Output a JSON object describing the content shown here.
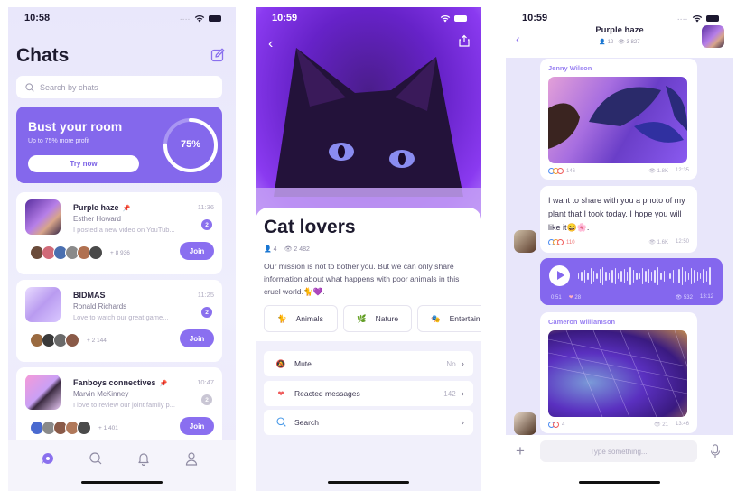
{
  "colors": {
    "accent": "#8468ec",
    "background": "#e9e7fb",
    "text_dark": "#1d1a2e"
  },
  "screen1": {
    "status_time": "10:58",
    "title": "Chats",
    "compose_icon": "edit-icon",
    "search_placeholder": "Search by chats",
    "promo": {
      "title": "Bust your room",
      "subtitle": "Up to 75% more profit",
      "button": "Try now",
      "progress_label": "75%",
      "progress_fraction": 0.75
    },
    "chats": [
      {
        "name": "Purple haze",
        "pinned": true,
        "author": "Esther Howard",
        "message": "I posted a new video on YouTub...",
        "time": "11:36",
        "unread": "2",
        "members_more": "+ 8 936",
        "join_label": "Join"
      },
      {
        "name": "BIDMAS",
        "pinned": false,
        "author": "Ronald Richards",
        "message": "Love to watch our great game...",
        "time": "11:25",
        "unread": "2",
        "members_more": "+ 2 144",
        "join_label": "Join"
      },
      {
        "name": "Fanboys connectives",
        "pinned": true,
        "author": "Marvin McKinney",
        "message": "I love to review our joint family p...",
        "time": "10:47",
        "unread": "2",
        "members_more": "+ 1 401",
        "join_label": "Join"
      }
    ],
    "tabs": [
      "chats-icon",
      "search-icon",
      "bell-icon",
      "profile-icon"
    ]
  },
  "screen2": {
    "status_time": "10:59",
    "title": "Cat lovers",
    "members": "4",
    "views": "2 482",
    "description": "Our mission is not to bother you. But we can only share information about what happens with poor animals in this cruel world.🐈💜.",
    "categories": [
      {
        "emoji": "🐈",
        "label": "Animals"
      },
      {
        "emoji": "🌿",
        "label": "Nature"
      },
      {
        "emoji": "🎭",
        "label": "Entertain"
      }
    ],
    "settings": [
      {
        "label": "Mute",
        "value": "No",
        "icon": "bell-slash-icon"
      },
      {
        "label": "Reacted messages",
        "value": "142",
        "icon": "heart-icon"
      },
      {
        "label": "Search",
        "value": "",
        "icon": "search-icon"
      }
    ]
  },
  "screen3": {
    "status_time": "10:59",
    "title": "Purple haze",
    "members": "12",
    "views": "3 827",
    "messages": [
      {
        "sender": "Jenny Wilson",
        "reactions": "146",
        "views": "1.8K",
        "time": "12:35"
      },
      {
        "text": "I want to share with you a photo of my plant that I took today. I hope you will like it😄🌸.",
        "reactions": "110",
        "views": "1.6K",
        "time": "12:50"
      },
      {
        "voice_duration": "0:51",
        "likes": "28",
        "views": "532",
        "time": "13:12"
      },
      {
        "sender": "Cameron Williamson",
        "reactions": "4",
        "views": "21",
        "time": "13:46"
      }
    ],
    "input_placeholder": "Type something..."
  }
}
